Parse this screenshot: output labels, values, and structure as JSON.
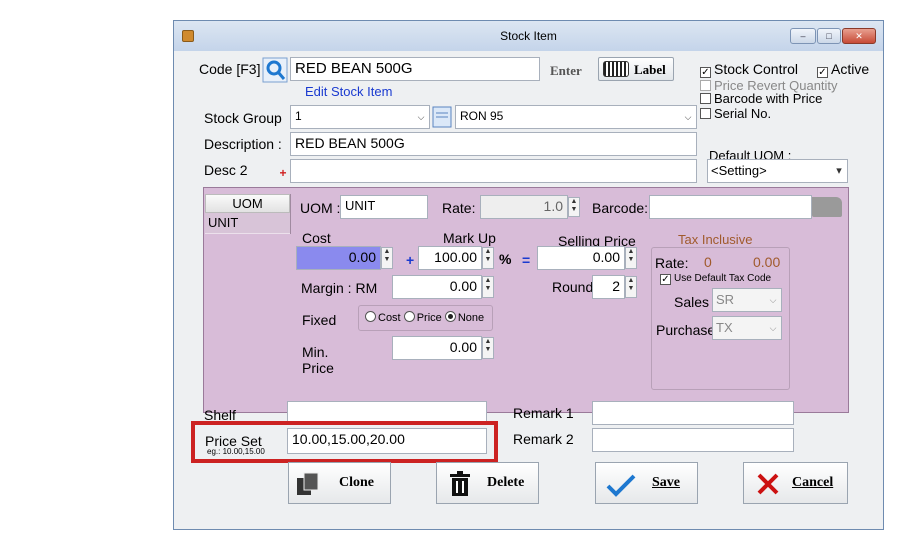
{
  "window": {
    "title": "Stock Item"
  },
  "code": {
    "label": "Code  [F3]",
    "value": "RED BEAN 500G",
    "edit_link": "Edit Stock Item"
  },
  "buttons": {
    "enter": "Enter",
    "label": "Label",
    "clone": "Clone",
    "delete": "Delete",
    "save": "Save",
    "cancel": "Cancel"
  },
  "checks": {
    "stock_control": "Stock Control",
    "active": "Active",
    "price_revert": "Price Revert Quantity",
    "barcode_price": "Barcode with Price",
    "serial_no": "Serial No."
  },
  "stock_group": {
    "label": "Stock Group",
    "value": "1",
    "group2": "RON 95"
  },
  "description": {
    "label": "Description :",
    "value": "RED BEAN 500G"
  },
  "desc2": {
    "label": "Desc 2",
    "value": ""
  },
  "default_uom": {
    "label": "Default UOM :",
    "value": "<Setting>"
  },
  "uom_list": {
    "header": "UOM",
    "items": [
      "UNIT"
    ]
  },
  "uom_detail": {
    "uom_label": "UOM :",
    "uom_value": "UNIT",
    "rate_label": "Rate:",
    "rate_value": "1.0",
    "barcode_label": "Barcode:",
    "cost_label": "Cost",
    "cost_value": "0.00",
    "markup_label": "Mark Up",
    "markup_value": "100.00",
    "plus": "+",
    "percent": "%",
    "equals": "=",
    "selling_label": "Selling Price",
    "selling_value": "0.00",
    "margin_label": "Margin : RM",
    "margin_value": "0.00",
    "round_label": "Round",
    "round_value": "2",
    "fixed_label": "Fixed",
    "fixed_options": [
      "Cost",
      "Price",
      "None"
    ],
    "min_price_label1": "Min.",
    "min_price_label2": "Price",
    "min_price_value": "0.00"
  },
  "tax": {
    "title": "Tax Inclusive",
    "rate_label": "Rate:",
    "rate_a": "0",
    "rate_b": "0.00",
    "use_default": "Use Default Tax Code",
    "sales_label": "Sales",
    "sales_value": "SR",
    "purchase_label": "Purchase",
    "purchase_value": "TX"
  },
  "shelf": {
    "label": "Shelf",
    "value": ""
  },
  "price_set": {
    "label": "Price Set",
    "hint": "eg.: 10.00,15.00",
    "value": "10.00,15.00,20.00"
  },
  "remark1": {
    "label": "Remark 1",
    "value": ""
  },
  "remark2": {
    "label": "Remark 2",
    "value": ""
  },
  "colors": {
    "highlight": "#cc2222",
    "purple_panel": "#d8bcd8",
    "tax_title": "#a05a2c"
  }
}
